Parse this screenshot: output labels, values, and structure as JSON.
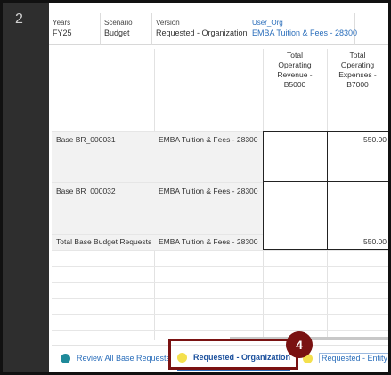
{
  "step_number": "2",
  "pov": [
    {
      "label": "Years",
      "value": "FY25"
    },
    {
      "label": "Scenario",
      "value": "Budget"
    },
    {
      "label": "Version",
      "value": "Requested - Organization"
    },
    {
      "label": "User_Org",
      "value": "EMBA Tuition & Fees - 28300"
    }
  ],
  "grid": {
    "columns": [
      "Total\nOperating\nRevenue -\nB5000",
      "Total\nOperating\nExpenses -\nB7000"
    ],
    "rows": [
      {
        "label": "Base BR_000031",
        "org": "EMBA Tuition & Fees - 28300",
        "revenue": "",
        "expenses": "550.00"
      },
      {
        "label": "Base BR_000032",
        "org": "EMBA Tuition & Fees - 28300",
        "revenue": "",
        "expenses": ""
      },
      {
        "label": "Total Base Budget Requests",
        "org": "EMBA Tuition & Fees - 28300",
        "revenue": "",
        "expenses": "550.00"
      }
    ]
  },
  "tabs": [
    {
      "label": "Review All Base Requests",
      "dot_color": "#1f8a9a"
    },
    {
      "label": "Requested - Organization",
      "dot_color": "#f4e04d"
    },
    {
      "label": "Requested - Entity",
      "dot_color": "#f4e04d"
    }
  ],
  "callout": {
    "number": "4",
    "color": "#7a1212"
  }
}
